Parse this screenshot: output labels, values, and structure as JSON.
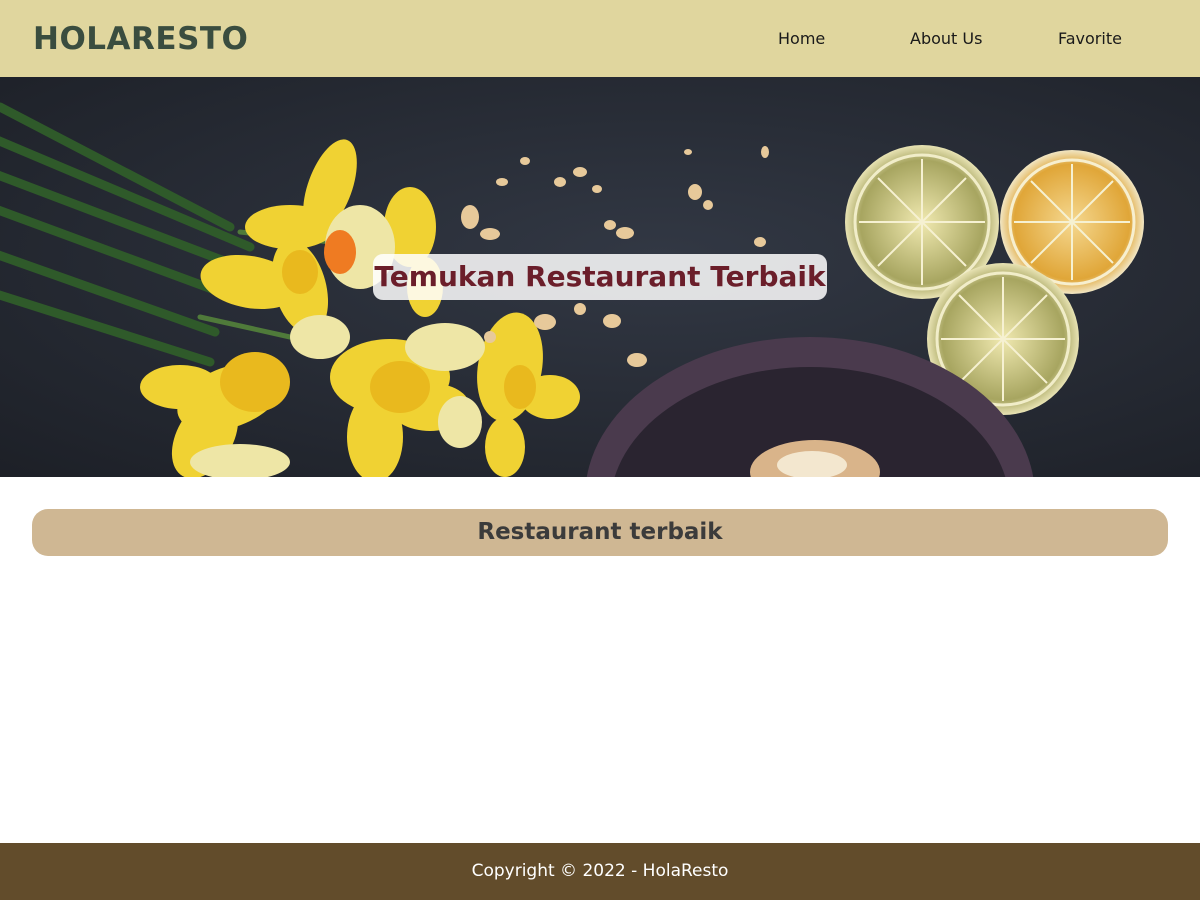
{
  "header": {
    "brand": "HOLARESTO",
    "nav": {
      "home": "Home",
      "about": "About Us",
      "favorite": "Favorite"
    }
  },
  "hero": {
    "title": "Temukan Restaurant Terbaik",
    "image": "hero-food-photo"
  },
  "main": {
    "section_title": "Restaurant terbaik"
  },
  "footer": {
    "copyright": "Copyright © 2022 - HolaResto"
  },
  "colors": {
    "header_bg": "#e0d69e",
    "brand_text": "#3a4d3f",
    "hero_title_text": "#6b1e2a",
    "section_heading_bg": "#cfb793",
    "footer_bg": "#624c2b"
  }
}
